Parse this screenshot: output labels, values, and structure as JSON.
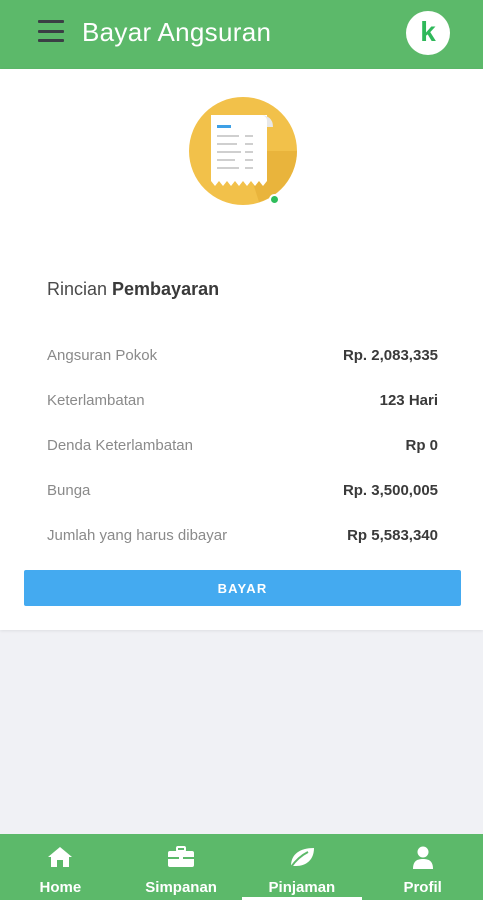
{
  "appbar": {
    "title": "Bayar Angsuran",
    "logo_letter": "k",
    "menu_icon": "hamburger-menu-icon",
    "brand_color": "#5cb96a"
  },
  "summary": {
    "heading_light": "Rincian ",
    "heading_bold": "Pembayaran",
    "rows": [
      {
        "label": "Angsuran Pokok",
        "value": "Rp. 2,083,335"
      },
      {
        "label": "Keterlambatan",
        "value": "123 Hari"
      },
      {
        "label": "Denda Keterlambatan",
        "value": "Rp 0"
      },
      {
        "label": "Bunga",
        "value": "Rp. 3,500,005"
      },
      {
        "label": "Jumlah yang harus dibayar",
        "value": "Rp 5,583,340"
      }
    ],
    "pay_button": "BAYAR",
    "pay_button_color": "#44aaf0"
  },
  "nav": {
    "items": [
      {
        "label": "Home",
        "icon": "home-icon"
      },
      {
        "label": "Simpanan",
        "icon": "briefcase-icon"
      },
      {
        "label": "Pinjaman",
        "icon": "leaf-icon",
        "active": true
      },
      {
        "label": "Profil",
        "icon": "user-icon"
      }
    ]
  }
}
